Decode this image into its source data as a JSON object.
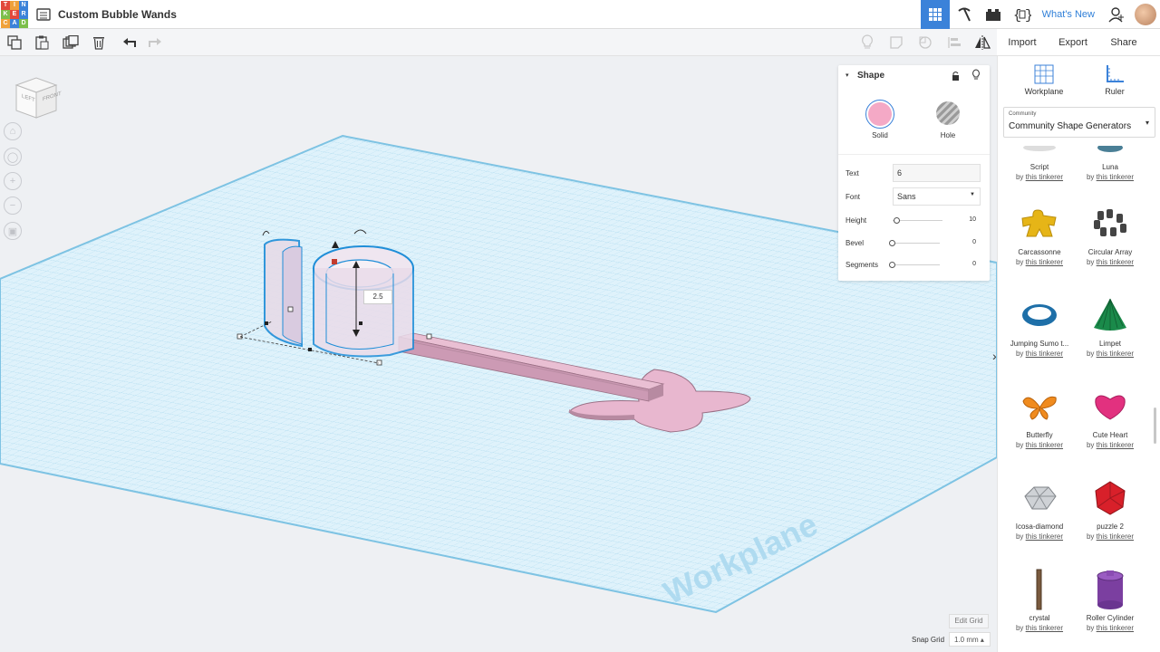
{
  "app": {
    "title": "Custom Bubble Wands",
    "logo_letters": [
      "T",
      "I",
      "N",
      "K",
      "E",
      "R",
      "C",
      "A",
      "D"
    ],
    "logo_colors": [
      "#e2483c",
      "#f0a13a",
      "#3b82d9",
      "#7cbf4a",
      "#e2483c",
      "#3b82d9",
      "#f0a13a",
      "#3b82d9",
      "#7cbf4a"
    ]
  },
  "top_right": {
    "whats_new": "What's New",
    "icons": [
      "grid-view-icon",
      "pickaxe-icon",
      "lego-brick-icon",
      "codeblocks-icon"
    ],
    "accent": "#3b82d9"
  },
  "edit_toolbar": {
    "icons": [
      "copy-icon",
      "paste-icon",
      "duplicate-icon",
      "delete-icon",
      "undo-icon",
      "redo-icon"
    ],
    "right_icons": [
      "show-icon",
      "note-icon",
      "hide-icon",
      "align-icon",
      "mirror-icon"
    ]
  },
  "actions": {
    "import": "Import",
    "export": "Export",
    "share": "Share"
  },
  "view_cube": {
    "left": "LEFT",
    "front": "FRONT"
  },
  "nav_controls": [
    "home-icon",
    "fit-icon",
    "zoom-in-icon",
    "zoom-out-icon",
    "perspective-icon"
  ],
  "shape_panel": {
    "title": "Shape",
    "solid_label": "Solid",
    "hole_label": "Hole",
    "solid_color": "#f4a9c6",
    "params": {
      "text_label": "Text",
      "text_value": "6",
      "font_label": "Font",
      "font_value": "Sans",
      "height_label": "Height",
      "height_value": "10",
      "bevel_label": "Bevel",
      "bevel_value": "0",
      "segments_label": "Segments",
      "segments_value": "0"
    },
    "levels": {
      "height": 0,
      "bevel": 0,
      "segments": 0
    }
  },
  "viewport": {
    "dimension_label": "2.5",
    "workplane_label": "Workplane",
    "edit_grid": "Edit Grid",
    "snap_grid_label": "Snap Grid",
    "snap_grid_value": "1.0 mm ▴"
  },
  "side_panel": {
    "workplane": "Workplane",
    "ruler": "Ruler",
    "category_small": "Community",
    "category": "Community Shape Generators",
    "shapes": [
      {
        "name": "Script",
        "by": "by",
        "author": "this tinkerer",
        "icon": "script-icon"
      },
      {
        "name": "Luna",
        "by": "by",
        "author": "this tinkerer",
        "icon": "luna-icon"
      },
      {
        "name": "Carcassonne",
        "by": "by",
        "author": "this tinkerer",
        "icon": "carcassonne-icon"
      },
      {
        "name": "Circular Array",
        "by": "by",
        "author": "this tinkerer",
        "icon": "circular-array-icon"
      },
      {
        "name": "Jumping Sumo t...",
        "by": "by",
        "author": "this tinkerer",
        "icon": "jumping-sumo-icon"
      },
      {
        "name": "Limpet",
        "by": "by",
        "author": "this tinkerer",
        "icon": "limpet-icon"
      },
      {
        "name": "Butterfly",
        "by": "by",
        "author": "this tinkerer",
        "icon": "butterfly-icon"
      },
      {
        "name": "Cute Heart",
        "by": "by",
        "author": "this tinkerer",
        "icon": "cute-heart-icon"
      },
      {
        "name": "Icosa-diamond",
        "by": "by",
        "author": "this tinkerer",
        "icon": "icosa-diamond-icon"
      },
      {
        "name": "puzzle 2",
        "by": "by",
        "author": "this tinkerer",
        "icon": "puzzle-icon"
      },
      {
        "name": "crystal",
        "by": "by",
        "author": "this tinkerer",
        "icon": "crystal-icon"
      },
      {
        "name": "Roller Cylinder",
        "by": "by",
        "author": "this tinkerer",
        "icon": "roller-cylinder-icon"
      }
    ]
  }
}
